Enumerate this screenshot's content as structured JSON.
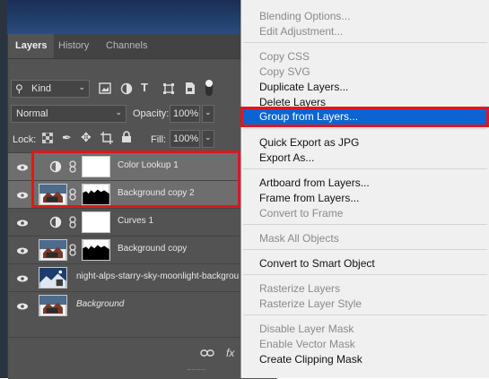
{
  "layers_panel": {
    "tabs": [
      "Layers",
      "History",
      "Channels"
    ],
    "filter": {
      "label": "Kind"
    },
    "blend_mode": "Normal",
    "opacity_label": "Opacity:",
    "opacity_value": "100%",
    "lock_label": "Lock:",
    "fill_label": "Fill:",
    "fill_value": "100%",
    "layers": [
      {
        "name": "Color Lookup 1",
        "type": "adjustment",
        "selected": true
      },
      {
        "name": "Background copy 2",
        "type": "pixel-mask",
        "selected": true
      },
      {
        "name": "Curves 1",
        "type": "adjustment",
        "selected": false
      },
      {
        "name": "Background copy",
        "type": "pixel-mask",
        "selected": false
      },
      {
        "name": "night-alps-starry-sky-moonlight-backgrou",
        "type": "smart",
        "selected": false
      },
      {
        "name": "Background",
        "type": "pixel",
        "selected": false
      }
    ],
    "footer_icons": [
      "link-icon",
      "fx-icon"
    ]
  },
  "context_menu": {
    "items": [
      {
        "label": "Blending Options...",
        "enabled": false
      },
      {
        "label": "Edit Adjustment...",
        "enabled": false
      },
      {
        "label": "Copy CSS",
        "enabled": false
      },
      {
        "label": "Copy SVG",
        "enabled": false
      },
      {
        "label": "Duplicate Layers...",
        "enabled": true
      },
      {
        "label": "Delete Layers",
        "enabled": true
      },
      {
        "label": "Group from Layers...",
        "enabled": true,
        "highlighted": true
      },
      {
        "label": "Quick Export as JPG",
        "enabled": true
      },
      {
        "label": "Export As...",
        "enabled": true
      },
      {
        "label": "Artboard from Layers...",
        "enabled": true
      },
      {
        "label": "Frame from Layers...",
        "enabled": true
      },
      {
        "label": "Convert to Frame",
        "enabled": false
      },
      {
        "label": "Mask All Objects",
        "enabled": false
      },
      {
        "label": "Convert to Smart Object",
        "enabled": true
      },
      {
        "label": "Rasterize Layers",
        "enabled": false
      },
      {
        "label": "Rasterize Layer Style",
        "enabled": false
      },
      {
        "label": "Disable Layer Mask",
        "enabled": false
      },
      {
        "label": "Enable Vector Mask",
        "enabled": false
      },
      {
        "label": "Create Clipping Mask",
        "enabled": true
      }
    ]
  },
  "colors": {
    "highlight": "#0b64d2",
    "annotation": "#e0161e",
    "panel": "#535353"
  }
}
